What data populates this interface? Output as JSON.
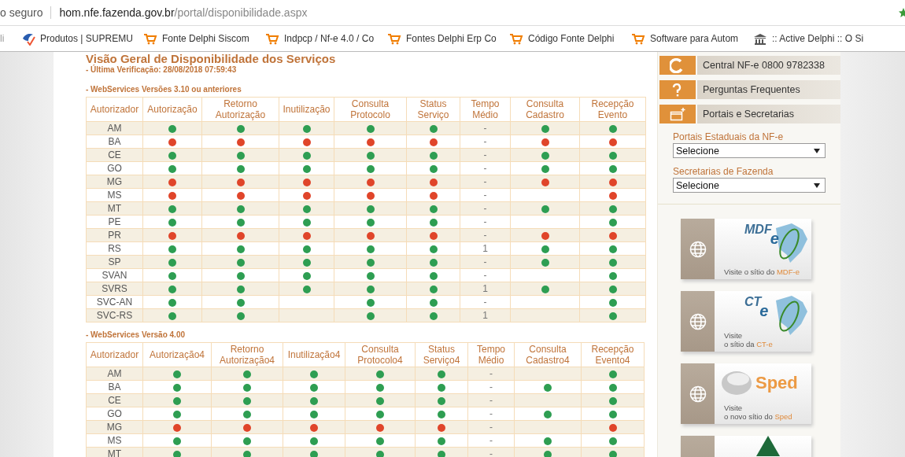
{
  "browser": {
    "security_label": "o seguro",
    "url_host": "hom.nfe.fazenda.gov.br",
    "url_path": "/portal/disponibilidade.aspx",
    "bookmarks": [
      {
        "label": "li",
        "kind": "cut"
      },
      {
        "label": "Produtos | SUPREMU",
        "kind": "site"
      },
      {
        "label": "Fonte Delphi Siscom",
        "kind": "cart"
      },
      {
        "label": "Indpcp / Nf-e 4.0 / Co",
        "kind": "cart"
      },
      {
        "label": "Fontes Delphi Erp Co",
        "kind": "cart"
      },
      {
        "label": "Código Fonte Delphi",
        "kind": "cart"
      },
      {
        "label": "Software para Autom",
        "kind": "cart"
      },
      {
        "label": ":: Active Delphi :: O Si",
        "kind": "building"
      }
    ]
  },
  "page": {
    "title": "Visão Geral de Disponibilidade dos Serviços",
    "last_check": "- Última Verificação: 28/08/2018 07:59:43",
    "tables": [
      {
        "caption": "- WebServices Versões 3.10 ou anteriores",
        "columns": [
          "Autorizador",
          "Autorização",
          "Retorno Autorização",
          "Inutilização",
          "Consulta Protocolo",
          "Status Serviço",
          "Tempo Médio",
          "Consulta Cadastro",
          "Recepção Evento"
        ],
        "rows": [
          {
            "name": "AM",
            "autorizacao": {
              "color": "#2e9e52"
            },
            "retorno_autorizacao": {
              "color": "#2e9e52"
            },
            "inutilizacao": {
              "color": "#2e9e52"
            },
            "consulta_protocolo": {
              "color": "#2e9e52"
            },
            "status_servico": {
              "color": "#2e9e52"
            },
            "tempo_medio": "-",
            "consulta_cadastro": {
              "color": "#2e9e52"
            },
            "recepcao_evento": {
              "color": "#2e9e52"
            }
          },
          {
            "name": "BA",
            "autorizacao": {
              "color": "#e0452a"
            },
            "retorno_autorizacao": {
              "color": "#e0452a"
            },
            "inutilizacao": {
              "color": "#e0452a"
            },
            "consulta_protocolo": {
              "color": "#e0452a"
            },
            "status_servico": {
              "color": "#e0452a"
            },
            "tempo_medio": "-",
            "consulta_cadastro": {
              "color": "#e0452a"
            },
            "recepcao_evento": {
              "color": "#e0452a"
            }
          },
          {
            "name": "CE",
            "autorizacao": {
              "color": "#2e9e52"
            },
            "retorno_autorizacao": {
              "color": "#2e9e52"
            },
            "inutilizacao": {
              "color": "#2e9e52"
            },
            "consulta_protocolo": {
              "color": "#2e9e52"
            },
            "status_servico": {
              "color": "#2e9e52"
            },
            "tempo_medio": "-",
            "consulta_cadastro": {
              "color": "#2e9e52"
            },
            "recepcao_evento": {
              "color": "#2e9e52"
            }
          },
          {
            "name": "GO",
            "autorizacao": {
              "color": "#2e9e52"
            },
            "retorno_autorizacao": {
              "color": "#2e9e52"
            },
            "inutilizacao": {
              "color": "#2e9e52"
            },
            "consulta_protocolo": {
              "color": "#2e9e52"
            },
            "status_servico": {
              "color": "#2e9e52"
            },
            "tempo_medio": "-",
            "consulta_cadastro": {
              "color": "#2e9e52"
            },
            "recepcao_evento": {
              "color": "#2e9e52"
            }
          },
          {
            "name": "MG",
            "autorizacao": {
              "color": "#e0452a"
            },
            "retorno_autorizacao": {
              "color": "#e0452a"
            },
            "inutilizacao": {
              "color": "#e0452a"
            },
            "consulta_protocolo": {
              "color": "#e0452a"
            },
            "status_servico": {
              "color": "#e0452a"
            },
            "tempo_medio": "-",
            "consulta_cadastro": {
              "color": "#e0452a"
            },
            "recepcao_evento": {
              "color": "#e0452a"
            }
          },
          {
            "name": "MS",
            "autorizacao": {
              "color": "#e0452a"
            },
            "retorno_autorizacao": {
              "color": "#e0452a"
            },
            "inutilizacao": {
              "color": "#e0452a"
            },
            "consulta_protocolo": {
              "color": "#e0452a"
            },
            "status_servico": {
              "color": "#e0452a"
            },
            "tempo_medio": "-",
            "recepcao_evento": {
              "color": "#e0452a"
            }
          },
          {
            "name": "MT",
            "autorizacao": {
              "color": "#2e9e52"
            },
            "retorno_autorizacao": {
              "color": "#2e9e52"
            },
            "inutilizacao": {
              "color": "#2e9e52"
            },
            "consulta_protocolo": {
              "color": "#2e9e52"
            },
            "status_servico": {
              "color": "#2e9e52"
            },
            "tempo_medio": "-",
            "consulta_cadastro": {
              "color": "#2e9e52"
            },
            "recepcao_evento": {
              "color": "#2e9e52"
            }
          },
          {
            "name": "PE",
            "autorizacao": {
              "color": "#2e9e52"
            },
            "retorno_autorizacao": {
              "color": "#2e9e52"
            },
            "inutilizacao": {
              "color": "#2e9e52"
            },
            "consulta_protocolo": {
              "color": "#2e9e52"
            },
            "status_servico": {
              "color": "#2e9e52"
            },
            "tempo_medio": "-",
            "recepcao_evento": {
              "color": "#2e9e52"
            }
          },
          {
            "name": "PR",
            "autorizacao": {
              "color": "#e0452a"
            },
            "retorno_autorizacao": {
              "color": "#e0452a"
            },
            "inutilizacao": {
              "color": "#e0452a"
            },
            "consulta_protocolo": {
              "color": "#e0452a"
            },
            "status_servico": {
              "color": "#e0452a"
            },
            "tempo_medio": "-",
            "consulta_cadastro": {
              "color": "#e0452a"
            },
            "recepcao_evento": {
              "color": "#e0452a"
            }
          },
          {
            "name": "RS",
            "autorizacao": {
              "color": "#2e9e52"
            },
            "retorno_autorizacao": {
              "color": "#2e9e52"
            },
            "inutilizacao": {
              "color": "#2e9e52"
            },
            "consulta_protocolo": {
              "color": "#2e9e52"
            },
            "status_servico": {
              "color": "#2e9e52"
            },
            "tempo_medio": "1",
            "consulta_cadastro": {
              "color": "#2e9e52"
            },
            "recepcao_evento": {
              "color": "#2e9e52"
            }
          },
          {
            "name": "SP",
            "autorizacao": {
              "color": "#2e9e52"
            },
            "retorno_autorizacao": {
              "color": "#2e9e52"
            },
            "inutilizacao": {
              "color": "#2e9e52"
            },
            "consulta_protocolo": {
              "color": "#2e9e52"
            },
            "status_servico": {
              "color": "#2e9e52"
            },
            "tempo_medio": "-",
            "consulta_cadastro": {
              "color": "#2e9e52"
            },
            "recepcao_evento": {
              "color": "#2e9e52"
            }
          },
          {
            "name": "SVAN",
            "autorizacao": {
              "color": "#2e9e52"
            },
            "retorno_autorizacao": {
              "color": "#2e9e52"
            },
            "inutilizacao": {
              "color": "#2e9e52"
            },
            "consulta_protocolo": {
              "color": "#2e9e52"
            },
            "status_servico": {
              "color": "#2e9e52"
            },
            "tempo_medio": "-",
            "recepcao_evento": {
              "color": "#2e9e52"
            }
          },
          {
            "name": "SVRS",
            "autorizacao": {
              "color": "#2e9e52"
            },
            "retorno_autorizacao": {
              "color": "#2e9e52"
            },
            "inutilizacao": {
              "color": "#2e9e52"
            },
            "consulta_protocolo": {
              "color": "#2e9e52"
            },
            "status_servico": {
              "color": "#2e9e52"
            },
            "tempo_medio": "1",
            "consulta_cadastro": {
              "color": "#2e9e52"
            },
            "recepcao_evento": {
              "color": "#2e9e52"
            }
          },
          {
            "name": "SVC-AN",
            "autorizacao": {
              "color": "#2e9e52"
            },
            "retorno_autorizacao": {
              "color": "#2e9e52"
            },
            "consulta_protocolo": {
              "color": "#2e9e52"
            },
            "status_servico": {
              "color": "#2e9e52"
            },
            "tempo_medio": "-",
            "recepcao_evento": {
              "color": "#2e9e52"
            }
          },
          {
            "name": "SVC-RS",
            "autorizacao": {
              "color": "#2e9e52"
            },
            "retorno_autorizacao": {
              "color": "#2e9e52"
            },
            "consulta_protocolo": {
              "color": "#2e9e52"
            },
            "status_servico": {
              "color": "#2e9e52"
            },
            "tempo_medio": "1",
            "recepcao_evento": {
              "color": "#2e9e52"
            }
          }
        ]
      },
      {
        "caption": "- WebServices Versão 4.00",
        "columns": [
          "Autorizador",
          "Autorização4",
          "Retorno Autorização4",
          "Inutilização4",
          "Consulta Protocolo4",
          "Status Serviço4",
          "Tempo Médio",
          "Consulta Cadastro4",
          "Recepção Evento4"
        ],
        "rows": [
          {
            "name": "AM",
            "autorizacao": {
              "color": "#2e9e52"
            },
            "retorno_autorizacao": {
              "color": "#2e9e52"
            },
            "inutilizacao": {
              "color": "#2e9e52"
            },
            "consulta_protocolo": {
              "color": "#2e9e52"
            },
            "status_servico": {
              "color": "#2e9e52"
            },
            "tempo_medio": "-",
            "recepcao_evento": {
              "color": "#2e9e52"
            }
          },
          {
            "name": "BA",
            "autorizacao": {
              "color": "#2e9e52"
            },
            "retorno_autorizacao": {
              "color": "#2e9e52"
            },
            "inutilizacao": {
              "color": "#2e9e52"
            },
            "consulta_protocolo": {
              "color": "#2e9e52"
            },
            "status_servico": {
              "color": "#2e9e52"
            },
            "tempo_medio": "-",
            "consulta_cadastro": {
              "color": "#2e9e52"
            },
            "recepcao_evento": {
              "color": "#2e9e52"
            }
          },
          {
            "name": "CE",
            "autorizacao": {
              "color": "#2e9e52"
            },
            "retorno_autorizacao": {
              "color": "#2e9e52"
            },
            "inutilizacao": {
              "color": "#2e9e52"
            },
            "consulta_protocolo": {
              "color": "#2e9e52"
            },
            "status_servico": {
              "color": "#2e9e52"
            },
            "tempo_medio": "-",
            "recepcao_evento": {
              "color": "#2e9e52"
            }
          },
          {
            "name": "GO",
            "autorizacao": {
              "color": "#2e9e52"
            },
            "retorno_autorizacao": {
              "color": "#2e9e52"
            },
            "inutilizacao": {
              "color": "#2e9e52"
            },
            "consulta_protocolo": {
              "color": "#2e9e52"
            },
            "status_servico": {
              "color": "#2e9e52"
            },
            "tempo_medio": "-",
            "consulta_cadastro": {
              "color": "#2e9e52"
            },
            "recepcao_evento": {
              "color": "#2e9e52"
            }
          },
          {
            "name": "MG",
            "autorizacao": {
              "color": "#e0452a"
            },
            "retorno_autorizacao": {
              "color": "#e0452a"
            },
            "inutilizacao": {
              "color": "#e0452a"
            },
            "consulta_protocolo": {
              "color": "#e0452a"
            },
            "status_servico": {
              "color": "#e0452a"
            },
            "tempo_medio": "-",
            "recepcao_evento": {
              "color": "#e0452a"
            }
          },
          {
            "name": "MS",
            "autorizacao": {
              "color": "#2e9e52"
            },
            "retorno_autorizacao": {
              "color": "#2e9e52"
            },
            "inutilizacao": {
              "color": "#2e9e52"
            },
            "consulta_protocolo": {
              "color": "#2e9e52"
            },
            "status_servico": {
              "color": "#2e9e52"
            },
            "tempo_medio": "-",
            "consulta_cadastro": {
              "color": "#2e9e52"
            },
            "recepcao_evento": {
              "color": "#2e9e52"
            }
          },
          {
            "name": "MT",
            "autorizacao": {
              "color": "#2e9e52"
            },
            "retorno_autorizacao": {
              "color": "#2e9e52"
            },
            "inutilizacao": {
              "color": "#2e9e52"
            },
            "consulta_protocolo": {
              "color": "#2e9e52"
            },
            "status_servico": {
              "color": "#2e9e52"
            },
            "tempo_medio": "-",
            "consulta_cadastro": {
              "color": "#2e9e52"
            },
            "recepcao_evento": {
              "color": "#2e9e52"
            }
          }
        ]
      }
    ]
  },
  "sidebar": {
    "links": [
      {
        "label": "Central NF-e 0800 9782338",
        "kind": "phone"
      },
      {
        "label": "Perguntas Frequentes",
        "kind": "question"
      },
      {
        "label": "Portais e Secretarias",
        "kind": "window"
      }
    ],
    "selects": [
      {
        "label": "Portais Estaduais da NF-e",
        "value": "Selecione"
      },
      {
        "label": "Secretarias de Fazenda",
        "value": "Selecione"
      }
    ],
    "banners": [
      {
        "kind": "mdfe",
        "logo": "MDF",
        "logo_mark": "e",
        "caption_lead": "Visite o sítio do ",
        "caption_brand": "MDF-e"
      },
      {
        "kind": "cte",
        "logo": "CT",
        "logo_mark": "e",
        "caption_lead": "Visite\no sítio da ",
        "caption_brand": "CT-e"
      },
      {
        "kind": "sped",
        "logo": "Sped",
        "caption_lead": "Visite\no novo sítio do ",
        "caption_brand": "Sped"
      },
      {
        "kind": "tree"
      }
    ]
  }
}
